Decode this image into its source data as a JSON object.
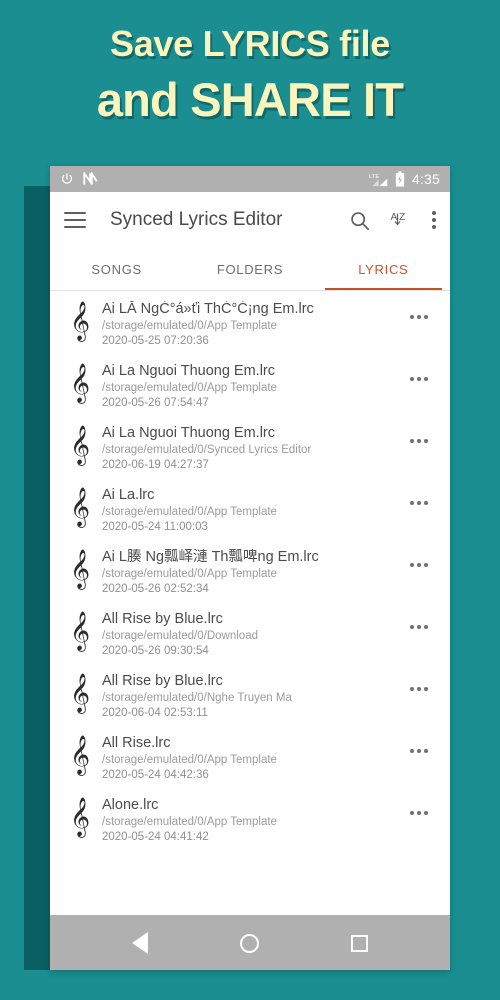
{
  "promo": {
    "line1": "Save LYRICS file",
    "line2": "and SHARE IT",
    "text_color": "#fbf5bd",
    "background_color": "#1a8e91"
  },
  "statusbar": {
    "icons": [
      "power-icon",
      "nfc-icon",
      "lte-signal-icon",
      "battery-icon"
    ],
    "lte_label": "LTE",
    "time": "4:35"
  },
  "appbar": {
    "menu_icon": "hamburger-menu-icon",
    "title": "Synced Lyrics Editor",
    "search_icon": "search-icon",
    "sort_icon": "sort-az-icon",
    "sort_label_top": "A",
    "sort_label_bottom": "Z",
    "overflow_icon": "overflow-menu-icon"
  },
  "tabs": {
    "active_index": 2,
    "active_color": "#d4502a",
    "items": [
      {
        "label": "SONGS"
      },
      {
        "label": "FOLDERS"
      },
      {
        "label": "LYRICS"
      }
    ]
  },
  "list": {
    "item_icon": "treble-clef-icon",
    "item_icon_glyph": "𝄞",
    "more_icon": "more-options-icon",
    "items": [
      {
        "title": "Ai LĂ  NgĆ°á»ťi ThĆ°Ć¡ng Em.lrc",
        "path": "/storage/emulated/0/App Template",
        "date": "2020-05-25 07:20:36"
      },
      {
        "title": "Ai La Nguoi Thuong Em.lrc",
        "path": "/storage/emulated/0/App Template",
        "date": "2020-05-26 07:54:47"
      },
      {
        "title": "Ai La Nguoi Thuong Em.lrc",
        "path": "/storage/emulated/0/Synced Lyrics Editor",
        "date": "2020-06-19 04:27:37"
      },
      {
        "title": "Ai La.lrc",
        "path": "/storage/emulated/0/App Template",
        "date": "2020-05-24 11:00:03"
      },
      {
        "title": "Ai L腠 Ng瓢峄漣 Th瓢啤ng Em.lrc",
        "path": "/storage/emulated/0/App Template",
        "date": "2020-05-26 02:52:34"
      },
      {
        "title": "All Rise by Blue.lrc",
        "path": "/storage/emulated/0/Download",
        "date": "2020-05-26 09:30:54"
      },
      {
        "title": "All Rise by Blue.lrc",
        "path": "/storage/emulated/0/Nghe Truyen Ma",
        "date": "2020-06-04 02:53:11"
      },
      {
        "title": "All Rise.lrc",
        "path": "/storage/emulated/0/App Template",
        "date": "2020-05-24 04:42:36"
      },
      {
        "title": "Alone.lrc",
        "path": "/storage/emulated/0/App Template",
        "date": "2020-05-24 04:41:42"
      }
    ]
  },
  "navbar": {
    "back_icon": "nav-back-icon",
    "home_icon": "nav-home-icon",
    "recents_icon": "nav-recents-icon"
  }
}
